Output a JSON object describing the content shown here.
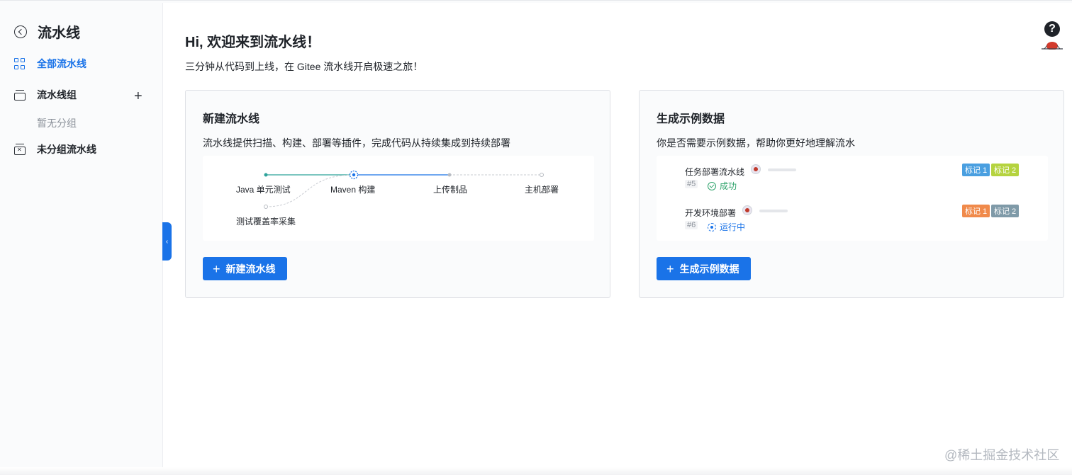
{
  "sidebar": {
    "title": "流水线",
    "items": [
      {
        "label": "全部流水线"
      },
      {
        "label": "流水线组"
      },
      {
        "label": "未分组流水线"
      }
    ],
    "group_empty": "暂无分组"
  },
  "main": {
    "greeting": "Hi, 欢迎来到流水线！",
    "subtitle": "三分钟从代码到上线，在 Gitee 流水线开启极速之旅！"
  },
  "new_pipeline_card": {
    "title": "新建流水线",
    "description": "流水线提供扫描、构建、部署等插件，完成代码从持续集成到持续部署",
    "stages": [
      "Java 单元测试",
      "Maven 构建",
      "上传制品",
      "主机部署",
      "测试覆盖率采集"
    ],
    "button_label": "新建流水线"
  },
  "sample_card": {
    "title": "生成示例数据",
    "description": "你是否需要示例数据，帮助你更好地理解流水",
    "rows": [
      {
        "name": "任务部署流水线",
        "number": "#5",
        "status": "成功",
        "tags": [
          "标记 1",
          "标记 2"
        ]
      },
      {
        "name": "开发环境部署",
        "number": "#6",
        "status": "运行中",
        "tags": [
          "标记 1",
          "标记 2"
        ]
      }
    ],
    "button_label": "生成示例数据"
  },
  "colors": {
    "accent": "#1a73e8",
    "success": "#2ea36b",
    "tag_blue": "#4a9fe0",
    "tag_lime": "#b5d33f",
    "tag_orange": "#f08a4b",
    "tag_slate": "#7f9aa8"
  },
  "footer": {
    "watermark": "@稀土掘金技术社区"
  },
  "icons": [
    "back-icon",
    "grid-icon",
    "group-icon",
    "plus-icon",
    "ungroup-icon",
    "help-icon",
    "collapse-arrow-icon",
    "success-icon",
    "running-icon"
  ]
}
